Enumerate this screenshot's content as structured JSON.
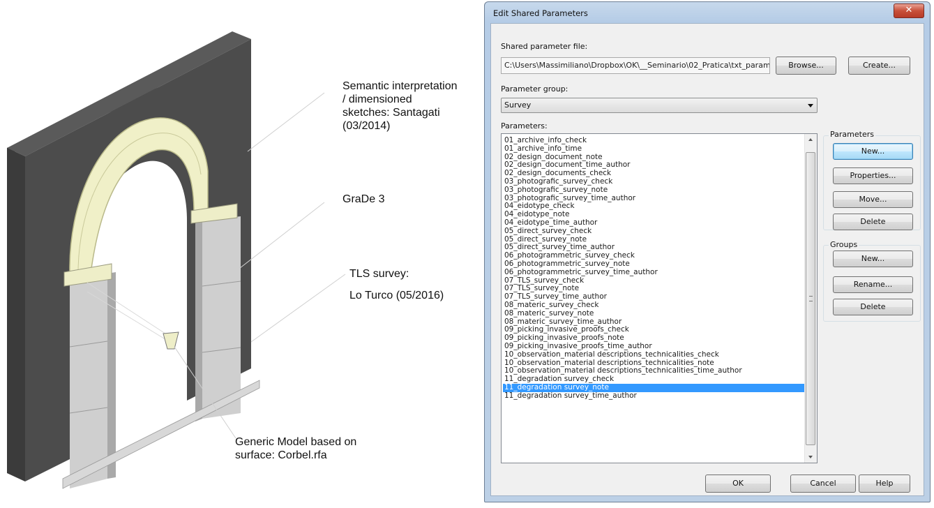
{
  "annotations": {
    "semantic": "Semantic interpretation\n/ dimensioned\nsketches: Santagati\n(03/2014)",
    "grade": "GraDe 3",
    "tls_line1": "TLS survey:",
    "tls_line2": "Lo Turco (05/2016)",
    "generic": "Generic Model based on\nsurface: Corbel.rfa"
  },
  "dialog": {
    "title": "Edit Shared Parameters",
    "close_glyph": "✕",
    "shared_file_label": "Shared parameter file:",
    "shared_file_value": "C:\\Users\\Massimiliano\\Dropbox\\OK\\__Seminario\\02_Pratica\\txt_param",
    "browse_label": "Browse...",
    "create_label": "Create...",
    "param_group_label": "Parameter group:",
    "param_group_value": "Survey",
    "parameters_label": "Parameters:",
    "parameters_box_title": "Parameters",
    "groups_box_title": "Groups",
    "param_buttons": {
      "new": "New...",
      "properties": "Properties...",
      "move": "Move...",
      "delete": "Delete"
    },
    "group_buttons": {
      "new": "New...",
      "rename": "Rename...",
      "delete": "Delete"
    },
    "ok_label": "OK",
    "cancel_label": "Cancel",
    "help_label": "Help",
    "selected_parameter": "11_degradation survey_note",
    "parameters": [
      "01_archive_info_check",
      "01_archive_info_time",
      "02_design_document_note",
      "02_design_document_time_author",
      "02_design_documents_check",
      "03_photografic_survey_check",
      "03_photografic_survey_note",
      "03_photografic_survey_time_author",
      "04_eidotype_check",
      "04_eidotype_note",
      "04_eidotype_time_author",
      "05_direct_survey_check",
      "05_direct_survey_note",
      "05_direct_survey_time_author",
      "06_photogrammetric_survey_check",
      "06_photogrammetric_survey_note",
      "06_photogrammetric_survey_time_author",
      "07_TLS_survey_check",
      "07_TLS_survey_note",
      "07_TLS_survey_time_author",
      "08_materic_survey_check",
      "08_materic_survey_note",
      "08_materic_survey_time_author",
      "09_picking_invasive_proofs_check",
      "09_picking_invasive_proofs_note",
      "09_picking_invasive_proofs_time_author",
      "10_observation_material descriptions_technicalities_check",
      "10_observation_material descriptions_technicalities_note",
      "10_observation_material descriptions_technicalities_time_author",
      "11_degradation survey_check",
      "11_degradation survey_note",
      "11_degradation survey_time_author"
    ]
  },
  "colors": {
    "wall": "#4b4b4b",
    "arch": "#f0f0c8",
    "pier": "#c8c8c8",
    "selection": "#3399ff",
    "close_button": "#c8503a"
  }
}
